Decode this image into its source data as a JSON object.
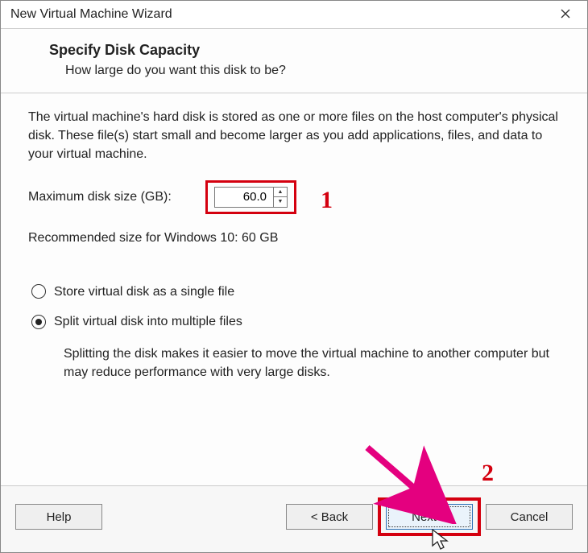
{
  "window": {
    "title": "New Virtual Machine Wizard"
  },
  "header": {
    "heading": "Specify Disk Capacity",
    "subheading": "How large do you want this disk to be?"
  },
  "body": {
    "description": "The virtual machine's hard disk is stored as one or more files on the host computer's physical disk. These file(s) start small and become larger as you add applications, files, and data to your virtual machine.",
    "disk_size_label": "Maximum disk size (GB):",
    "disk_size_value": "60.0",
    "recommended": "Recommended size for Windows 10: 60 GB",
    "radio_single": "Store virtual disk as a single file",
    "radio_split": "Split virtual disk into multiple files",
    "split_desc": "Splitting the disk makes it easier to move the virtual machine to another computer but may reduce performance with very large disks.",
    "selected_option": "split"
  },
  "buttons": {
    "help": "Help",
    "back": "< Back",
    "next": "Next >",
    "cancel": "Cancel"
  },
  "annotations": {
    "label1": "1",
    "label2": "2",
    "highlight_color": "#d4000f"
  }
}
